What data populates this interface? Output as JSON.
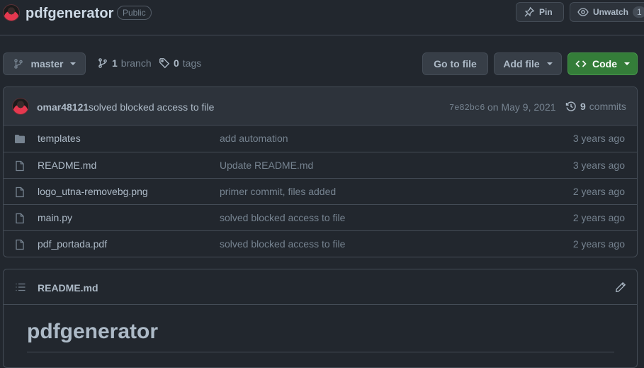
{
  "repo": {
    "name": "pdfgenerator",
    "visibility": "Public"
  },
  "header_actions": {
    "pin_label": "Pin",
    "unwatch_label": "Unwatch",
    "watch_count": "1"
  },
  "toolbar": {
    "branch_name": "master",
    "branch_count": "1",
    "branch_word": "branch",
    "tag_count": "0",
    "tag_word": "tags",
    "go_to_file": "Go to file",
    "add_file": "Add file",
    "code": "Code"
  },
  "latest_commit": {
    "author": "omar48121",
    "message": "solved blocked access to file",
    "sha": "7e82bc6",
    "date": "on May 9, 2021",
    "commit_count": "9",
    "commit_word": "commits"
  },
  "files": [
    {
      "name": "templates",
      "type": "folder",
      "message": "add automation",
      "age": "3 years ago"
    },
    {
      "name": "README.md",
      "type": "file",
      "message": "Update README.md",
      "age": "3 years ago"
    },
    {
      "name": "logo_utna-removebg.png",
      "type": "file",
      "message": "primer commit, files added",
      "age": "2 years ago"
    },
    {
      "name": "main.py",
      "type": "file",
      "message": "solved blocked access to file",
      "age": "2 years ago"
    },
    {
      "name": "pdf_portada.pdf",
      "type": "file",
      "message": "solved blocked access to file",
      "age": "2 years ago"
    }
  ],
  "readme": {
    "filename": "README.md",
    "heading": "pdfgenerator"
  },
  "colors": {
    "background": "#22272e",
    "code_button": "#347d39",
    "link": "#adbac7",
    "muted": "#768390",
    "border": "#444c56"
  }
}
